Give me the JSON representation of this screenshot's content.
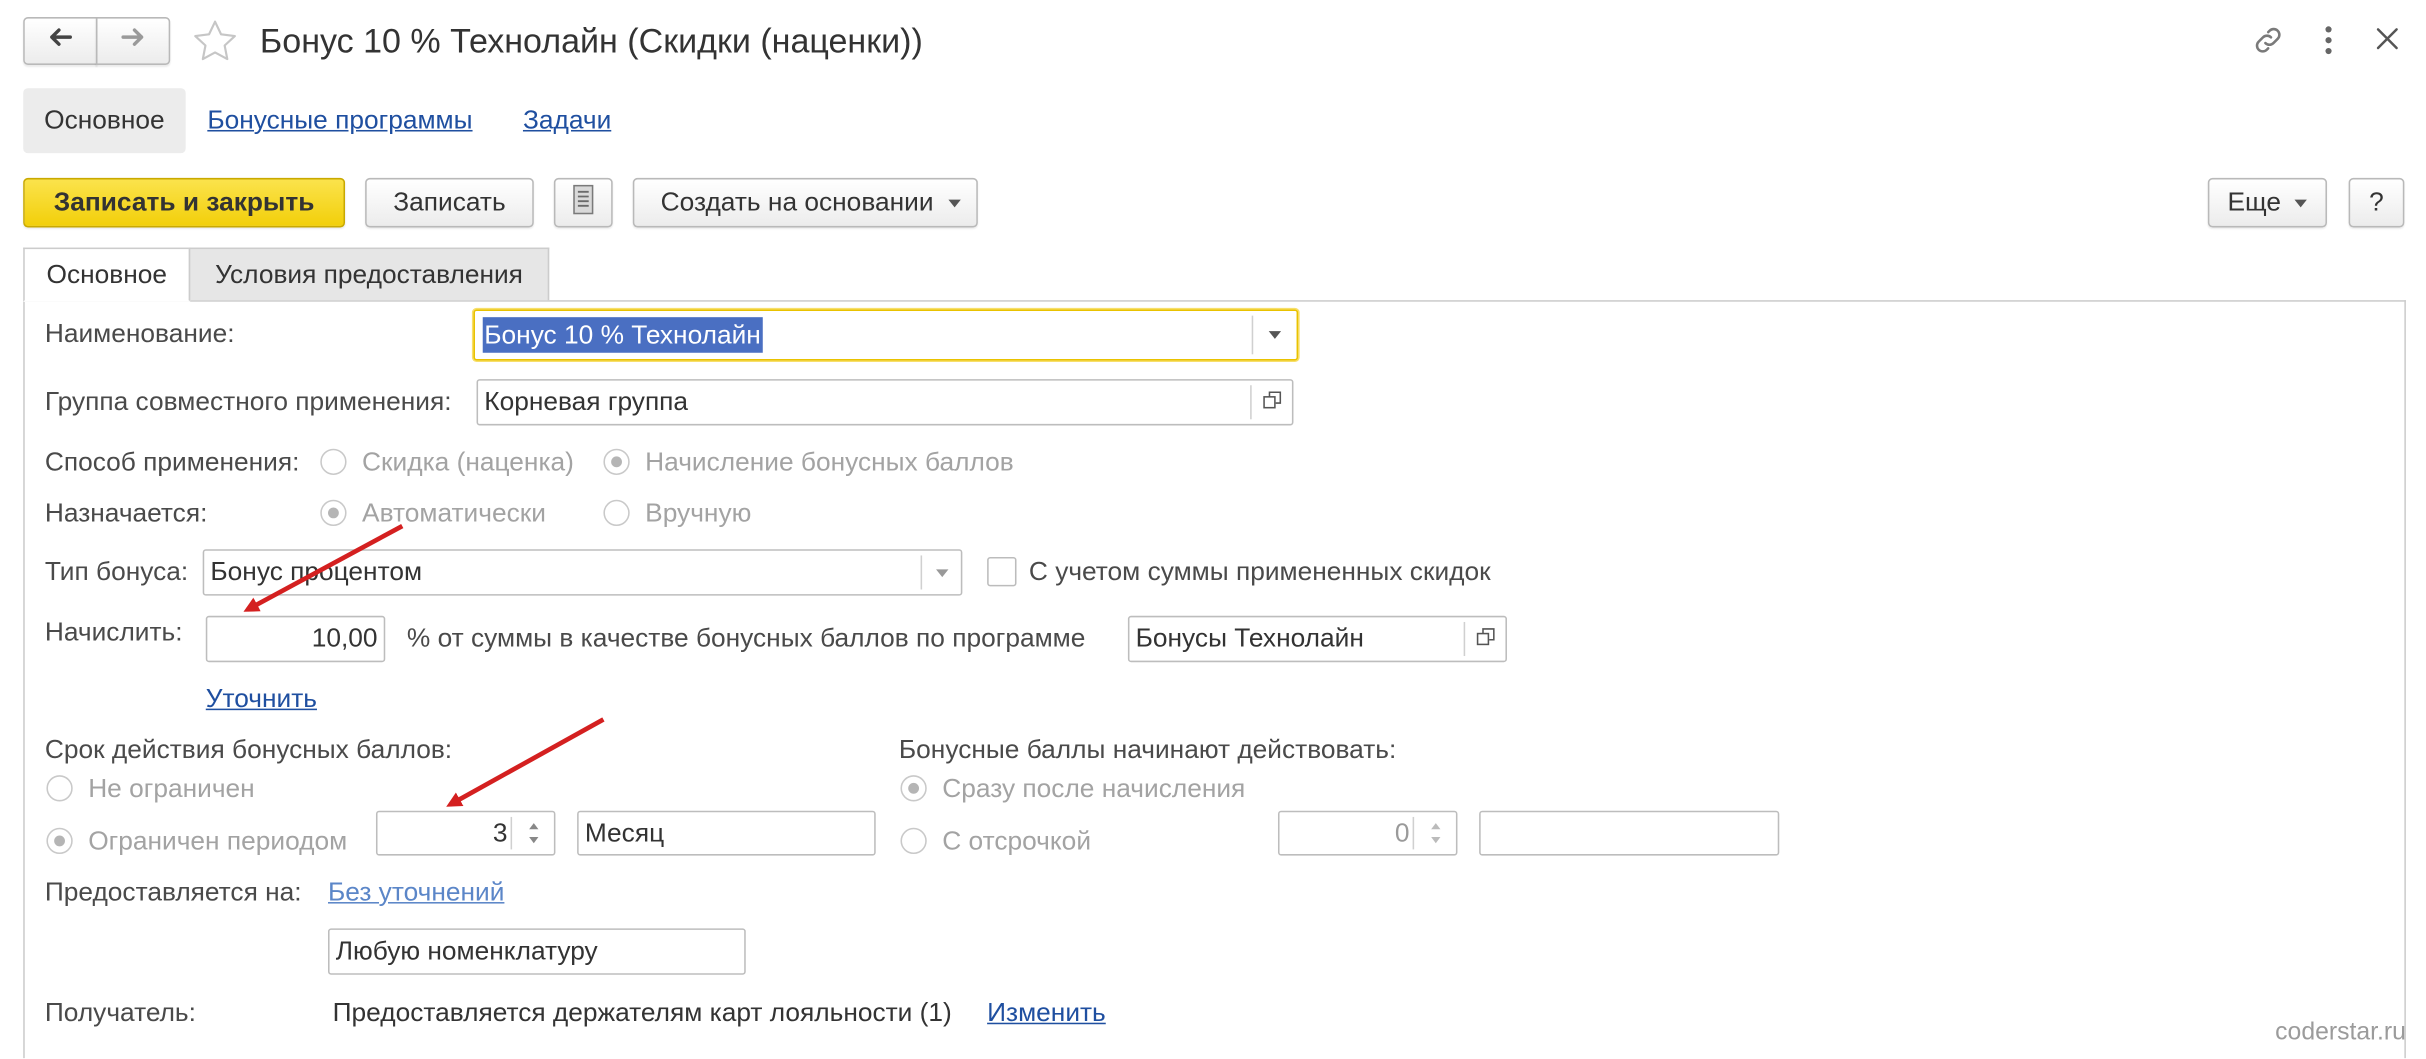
{
  "window": {
    "title": "Бонус 10 % Технолайн (Скидки (наценки))"
  },
  "icons": {
    "back": "back-arrow-icon",
    "forward": "forward-arrow-icon",
    "favorite": "star-icon",
    "link": "link-icon",
    "more": "more-vertical-icon",
    "close": "close-icon",
    "report": "list-document-icon",
    "dropdown": "chevron-down-icon",
    "open": "open-form-icon",
    "spinner": "spinner-icon"
  },
  "nav": {
    "items": [
      {
        "label": "Основное",
        "active": true
      },
      {
        "label": "Бонусные программы",
        "active": false
      },
      {
        "label": "Задачи",
        "active": false
      }
    ]
  },
  "toolbar": {
    "save_close": "Записать и закрыть",
    "save": "Записать",
    "create_based": "Создать на основании",
    "more": "Еще",
    "help": "?"
  },
  "tabs": [
    {
      "label": "Основное",
      "active": true
    },
    {
      "label": "Условия предоставления",
      "active": false
    }
  ],
  "form": {
    "name": {
      "label": "Наименование:",
      "value": "Бонус 10 % Технолайн"
    },
    "group": {
      "label": "Группа совместного применения:",
      "value": "Корневая группа"
    },
    "method": {
      "label": "Способ применения:",
      "options": [
        "Скидка (наценка)",
        "Начисление бонусных баллов"
      ],
      "selected": 1
    },
    "assigned": {
      "label": "Назначается:",
      "options": [
        "Автоматически",
        "Вручную"
      ],
      "selected": 0
    },
    "bonus_type": {
      "label": "Тип бонуса:",
      "value": "Бонус процентом",
      "checkbox_label": "С учетом суммы примененных скидок",
      "checked": false
    },
    "accrue": {
      "label": "Начислить:",
      "value": "10,00",
      "text": "% от суммы в качестве бонусных баллов по программе",
      "program": "Бонусы Технолайн",
      "refine_link": "Уточнить"
    },
    "validity": {
      "label": "Срок действия бонусных баллов:",
      "options": [
        "Не ограничен",
        "Ограничен периодом"
      ],
      "selected": 1,
      "period_count": "3",
      "period_unit": "Месяц"
    },
    "start": {
      "label": "Бонусные баллы начинают действовать:",
      "options": [
        "Сразу после начисления",
        "С отсрочкой"
      ],
      "selected": 0,
      "delay_count": "0",
      "delay_unit": ""
    },
    "provided_for": {
      "label": "Предоставляется на:",
      "link": "Без уточнений",
      "value": "Любую номенклатуру"
    },
    "recipient": {
      "label": "Получатель:",
      "text": "Предоставляется держателям карт лояльности (1)",
      "link": "Изменить"
    }
  },
  "watermark": "coderstar.ru",
  "colors": {
    "accent_yellow": "#f2cf0a",
    "link": "#1f4fa0",
    "link_light": "#5b86c8",
    "selection": "#4a6fc2",
    "annotation_arrow": "#d42020"
  }
}
